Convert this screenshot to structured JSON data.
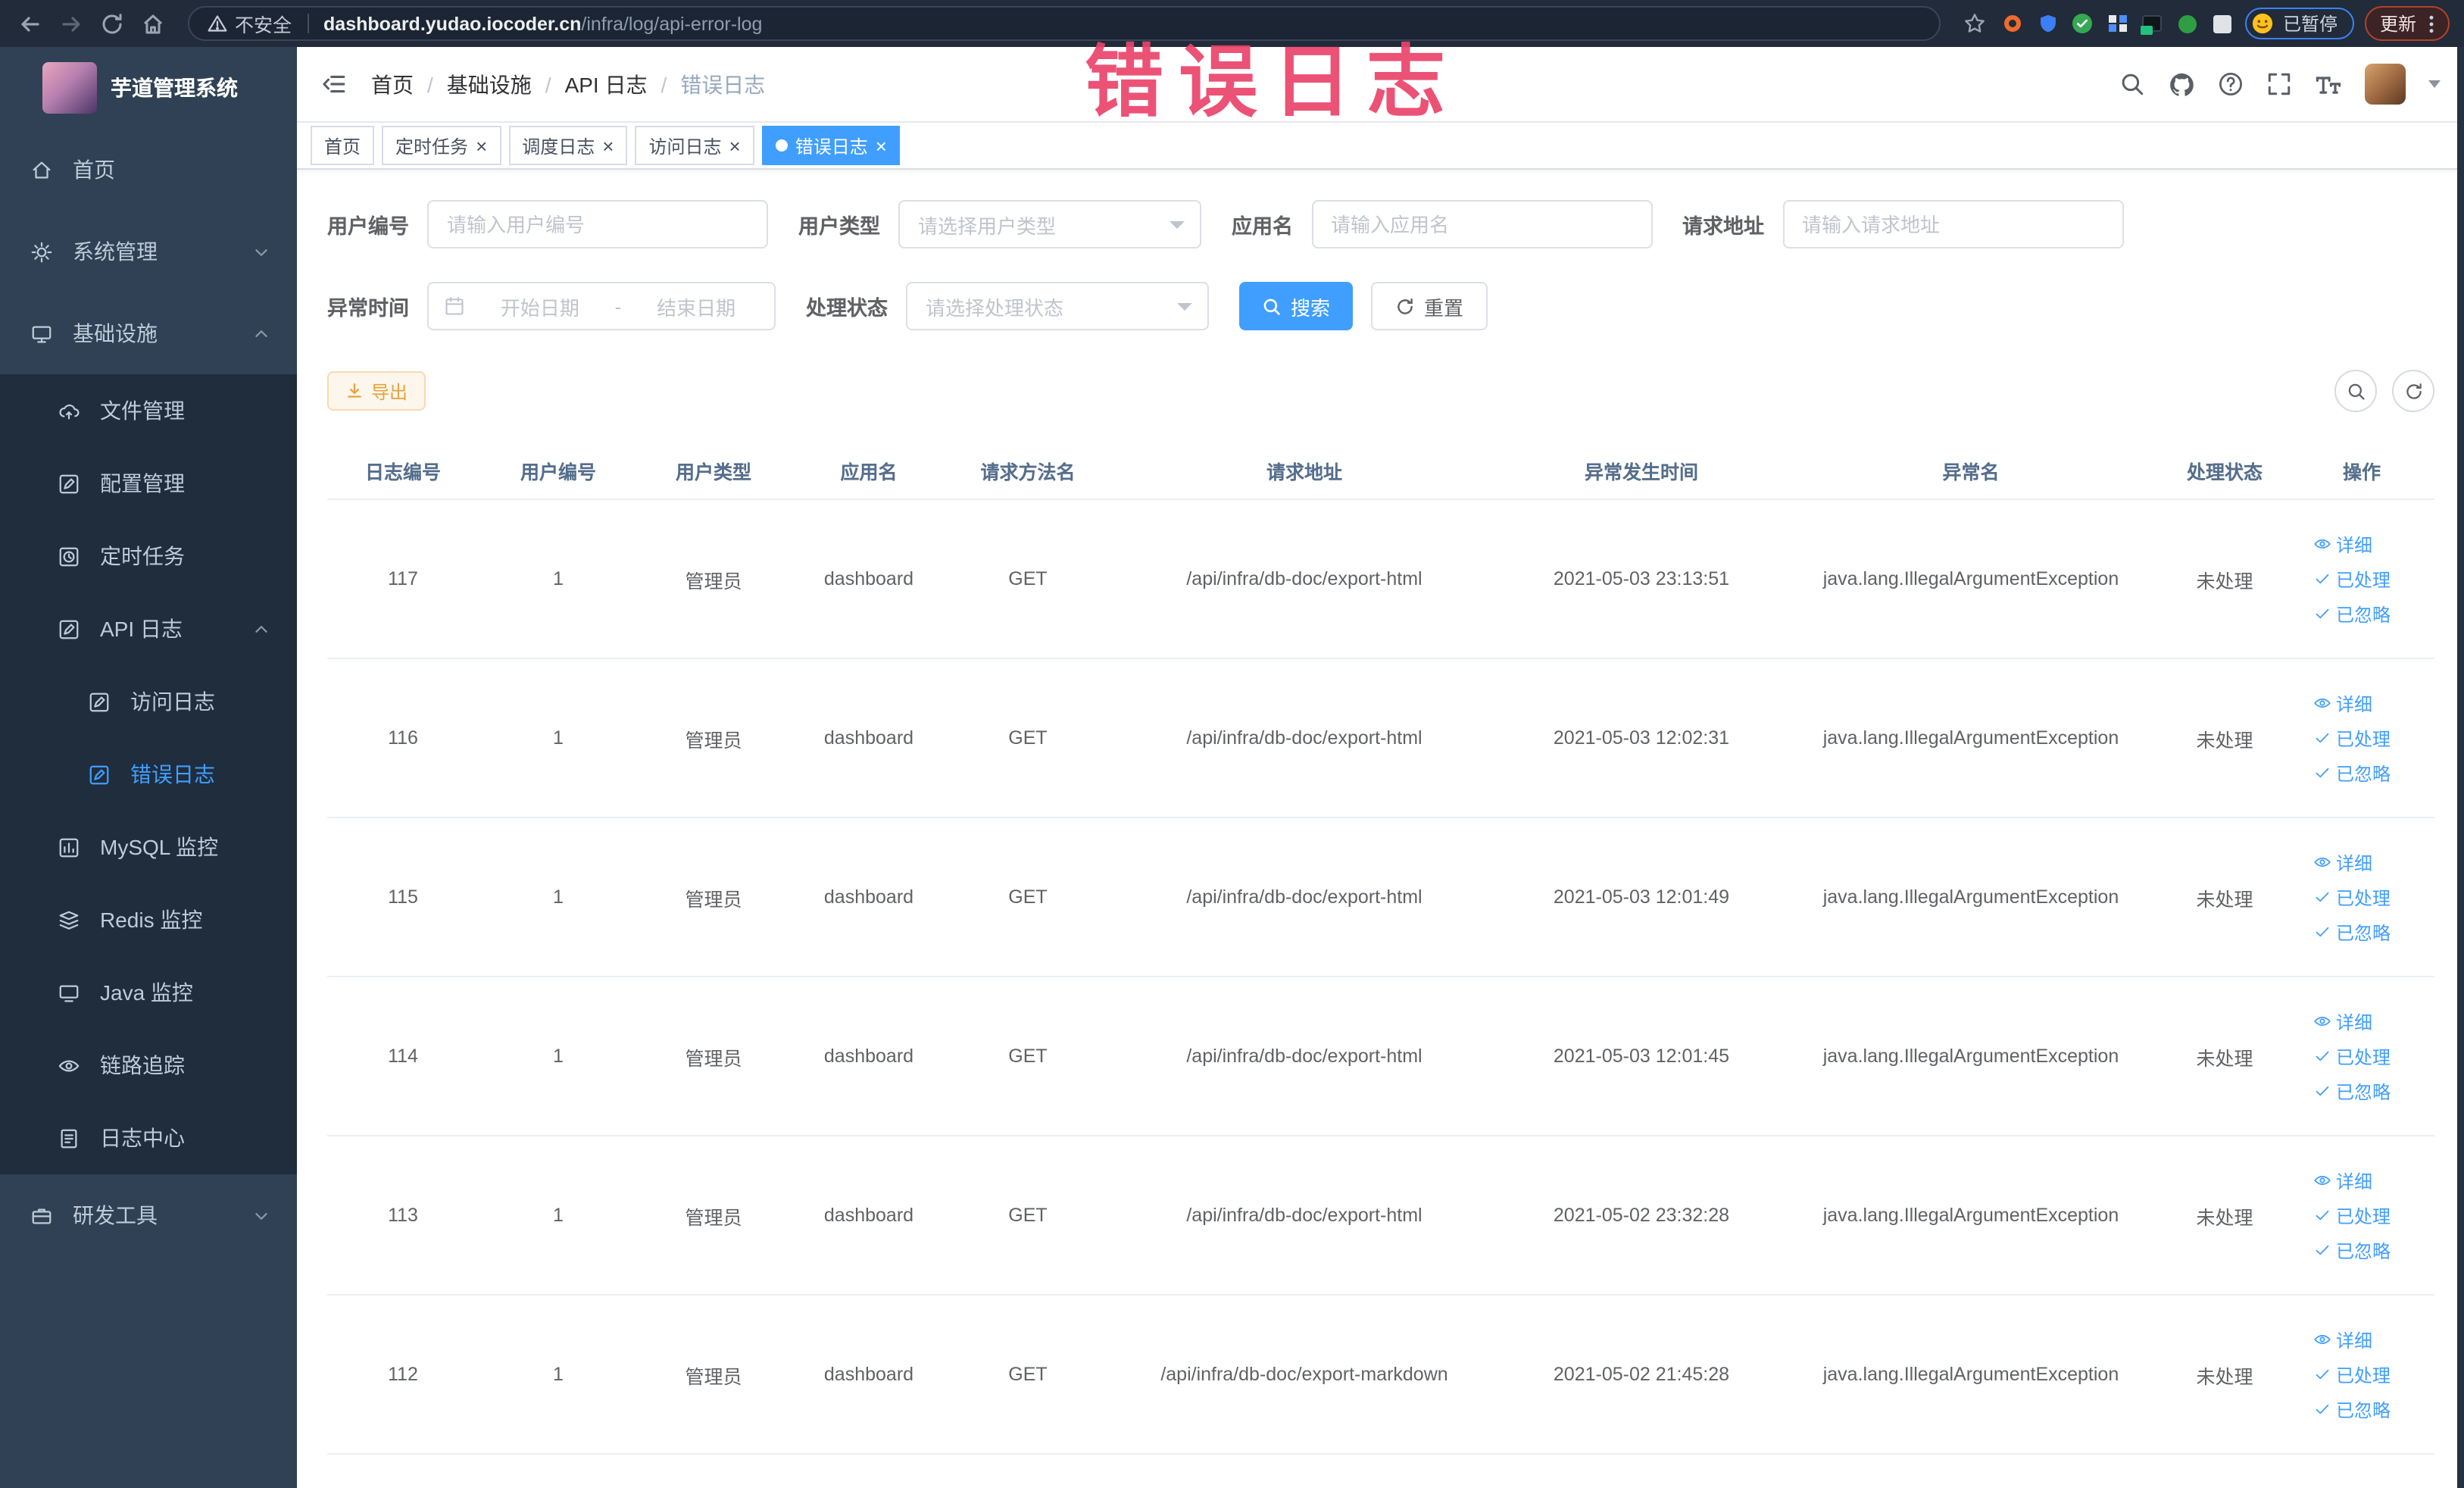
{
  "browser": {
    "security_warning": "不安全",
    "url_host": "dashboard.yudao.iocoder.cn",
    "url_path": "/infra/log/api-error-log",
    "paused_badge": "已暂停",
    "update_button": "更新"
  },
  "annotation": {
    "text": "错误日志"
  },
  "sidebar": {
    "logo_title": "芋道管理系统",
    "items": [
      {
        "key": "home",
        "label": "首页",
        "icon": "home",
        "level": 0
      },
      {
        "key": "system-mgmt",
        "label": "系统管理",
        "icon": "gear",
        "level": 0,
        "chevron": "down"
      },
      {
        "key": "infrastructure",
        "label": "基础设施",
        "icon": "infra",
        "level": 0,
        "chevron": "up"
      },
      {
        "key": "file-mgmt",
        "label": "文件管理",
        "icon": "cloud",
        "level": 1
      },
      {
        "key": "config-mgmt",
        "label": "配置管理",
        "icon": "edit",
        "level": 1
      },
      {
        "key": "scheduled-task",
        "label": "定时任务",
        "icon": "clock",
        "level": 1
      },
      {
        "key": "api-log",
        "label": "API 日志",
        "icon": "edit",
        "level": 1,
        "chevron": "up"
      },
      {
        "key": "access-log",
        "label": "访问日志",
        "icon": "edit",
        "level": 2
      },
      {
        "key": "error-log",
        "label": "错误日志",
        "icon": "edit",
        "level": 2,
        "active": true
      },
      {
        "key": "mysql-monitor",
        "label": "MySQL 监控",
        "icon": "chart",
        "level": 1
      },
      {
        "key": "redis-monitor",
        "label": "Redis 监控",
        "icon": "layers",
        "level": 1
      },
      {
        "key": "java-monitor",
        "label": "Java 监控",
        "icon": "monitor",
        "level": 1
      },
      {
        "key": "trace",
        "label": "链路追踪",
        "icon": "eye",
        "level": 1
      },
      {
        "key": "log-center",
        "label": "日志中心",
        "icon": "doc",
        "level": 1
      },
      {
        "key": "dev-tools",
        "label": "研发工具",
        "icon": "case",
        "level": 0,
        "chevron": "down"
      }
    ]
  },
  "breadcrumb": [
    "首页",
    "基础设施",
    "API 日志",
    "错误日志"
  ],
  "tabs": [
    {
      "label": "首页",
      "closable": false,
      "active": false
    },
    {
      "label": "定时任务",
      "closable": true,
      "active": false
    },
    {
      "label": "调度日志",
      "closable": true,
      "active": false
    },
    {
      "label": "访问日志",
      "closable": true,
      "active": false
    },
    {
      "label": "错误日志",
      "closable": true,
      "active": true
    }
  ],
  "filters": {
    "user_id": {
      "label": "用户编号",
      "placeholder": "请输入用户编号"
    },
    "user_type": {
      "label": "用户类型",
      "placeholder": "请选择用户类型"
    },
    "app_name": {
      "label": "应用名",
      "placeholder": "请输入应用名"
    },
    "request_url": {
      "label": "请求地址",
      "placeholder": "请输入请求地址"
    },
    "exception_time": {
      "label": "异常时间",
      "start_placeholder": "开始日期",
      "separator": "-",
      "end_placeholder": "结束日期"
    },
    "process_status": {
      "label": "处理状态",
      "placeholder": "请选择处理状态"
    },
    "search_label": "搜索",
    "reset_label": "重置"
  },
  "toolbar": {
    "export_label": "导出"
  },
  "table": {
    "headers": [
      "日志编号",
      "用户编号",
      "用户类型",
      "应用名",
      "请求方法名",
      "请求地址",
      "异常发生时间",
      "异常名",
      "处理状态",
      "操作"
    ],
    "actions": {
      "detail": "详细",
      "processed": "已处理",
      "ignored": "已忽略"
    },
    "rows": [
      {
        "id": "117",
        "user_id": "1",
        "user_type": "管理员",
        "app": "dashboard",
        "method": "GET",
        "url": "/api/infra/db-doc/export-html",
        "time": "2021-05-03 23:13:51",
        "exception": "java.lang.IllegalArgumentException",
        "status": "未处理"
      },
      {
        "id": "116",
        "user_id": "1",
        "user_type": "管理员",
        "app": "dashboard",
        "method": "GET",
        "url": "/api/infra/db-doc/export-html",
        "time": "2021-05-03 12:02:31",
        "exception": "java.lang.IllegalArgumentException",
        "status": "未处理"
      },
      {
        "id": "115",
        "user_id": "1",
        "user_type": "管理员",
        "app": "dashboard",
        "method": "GET",
        "url": "/api/infra/db-doc/export-html",
        "time": "2021-05-03 12:01:49",
        "exception": "java.lang.IllegalArgumentException",
        "status": "未处理"
      },
      {
        "id": "114",
        "user_id": "1",
        "user_type": "管理员",
        "app": "dashboard",
        "method": "GET",
        "url": "/api/infra/db-doc/export-html",
        "time": "2021-05-03 12:01:45",
        "exception": "java.lang.IllegalArgumentException",
        "status": "未处理"
      },
      {
        "id": "113",
        "user_id": "1",
        "user_type": "管理员",
        "app": "dashboard",
        "method": "GET",
        "url": "/api/infra/db-doc/export-html",
        "time": "2021-05-02 23:32:28",
        "exception": "java.lang.IllegalArgumentException",
        "status": "未处理"
      },
      {
        "id": "112",
        "user_id": "1",
        "user_type": "管理员",
        "app": "dashboard",
        "method": "GET",
        "url": "/api/infra/db-doc/export-markdown",
        "time": "2021-05-02 21:45:28",
        "exception": "java.lang.IllegalArgumentException",
        "status": "未处理"
      }
    ]
  },
  "colors": {
    "accent": "#409eff",
    "warning": "#e6a23c",
    "annotation": "#e9436a",
    "sidebar_bg": "#304156",
    "submenu_bg": "#1f2d3d"
  }
}
